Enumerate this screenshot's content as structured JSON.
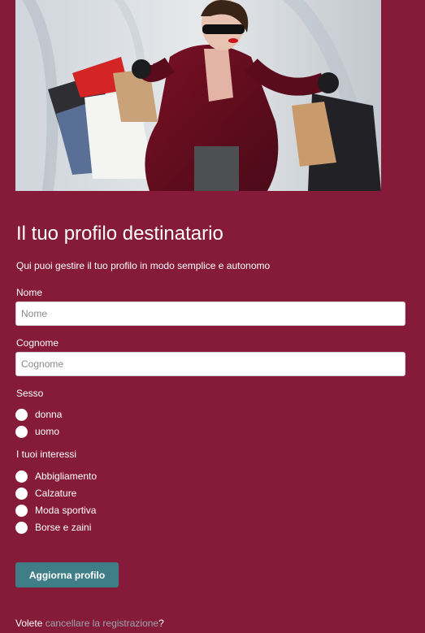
{
  "hero": {
    "image_label": "shopping-woman-photo"
  },
  "form": {
    "title": "Il tuo profilo destinatario",
    "subtitle": "Qui puoi gestire il tuo profilo in modo semplice e autonomo",
    "first_name": {
      "label": "Nome",
      "placeholder": "Nome",
      "value": ""
    },
    "last_name": {
      "label": "Cognome",
      "placeholder": "Cognome",
      "value": ""
    },
    "gender": {
      "label": "Sesso",
      "options": [
        "donna",
        "uomo"
      ]
    },
    "interests": {
      "label": "I tuoi interessi",
      "options": [
        "Abbigliamento",
        "Calzature",
        "Moda sportiva",
        "Borse e zaini"
      ]
    },
    "submit_label": "Aggiorna profilo"
  },
  "footer": {
    "prefix": "Volete ",
    "link_text": "cancellare la registrazione",
    "suffix": "?"
  },
  "colors": {
    "background": "#861a39",
    "button": "#3f7e86",
    "link": "#9aa6ab"
  }
}
